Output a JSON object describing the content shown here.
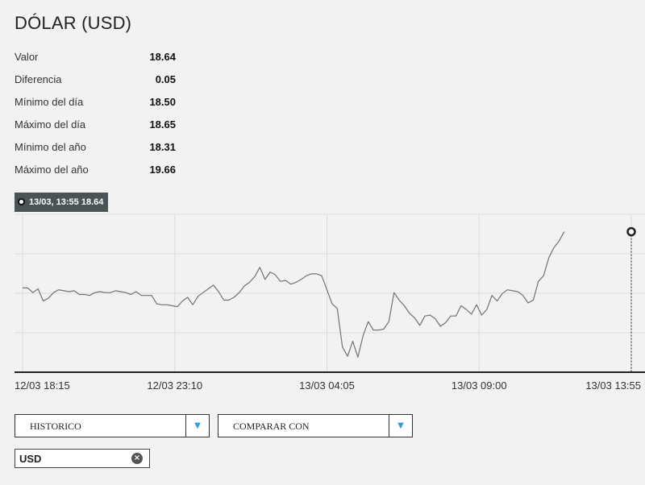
{
  "header": {
    "title": "DÓLAR (USD)"
  },
  "stats": [
    {
      "label": "Valor",
      "value": "18.64"
    },
    {
      "label": "Diferencia",
      "value": "0.05"
    },
    {
      "label": "Mínimo del día",
      "value": "18.50"
    },
    {
      "label": "Máximo del día",
      "value": "18.65"
    },
    {
      "label": "Mínimo del año",
      "value": "18.31"
    },
    {
      "label": "Máximo del año",
      "value": "19.66"
    }
  ],
  "tooltip": {
    "text": "13/03, 13:55 18.64"
  },
  "controls": {
    "historico_label": "HISTORICO",
    "comparar_label": "COMPARAR CON",
    "dropdown_arrow": "▼",
    "chip_label": "USD",
    "chip_close": "×"
  },
  "colors": {
    "line": "#6d7474",
    "grid": "#dcdcdc",
    "axis": "#222222",
    "tooltip_bg": "#4a5456",
    "dropdown_arrow": "#3a9ad9"
  },
  "chart_data": {
    "type": "line",
    "x_tick_labels": [
      "12/03 18:15",
      "12/03 23:10",
      "13/03 04:05",
      "13/03 09:00",
      "13/03 13:55"
    ],
    "x_range": [
      "12/03 18:15",
      "13/03 13:55"
    ],
    "ylim": [
      18.49,
      18.65
    ],
    "grid": true,
    "series": [
      {
        "x_minutes": [
          0,
          10,
          20,
          30,
          40,
          50,
          60,
          70,
          80,
          90,
          100,
          110,
          120,
          130,
          140,
          150,
          160,
          170,
          180,
          190,
          200,
          210,
          220,
          230,
          240,
          250,
          260,
          270,
          280,
          290,
          300,
          310,
          320,
          330,
          340,
          350,
          360,
          370,
          380,
          390,
          400,
          410,
          420,
          430,
          440,
          450,
          460,
          470,
          480,
          490,
          500,
          510,
          520,
          530,
          540,
          550,
          560,
          570,
          580,
          590,
          600,
          610,
          620,
          630,
          640,
          650,
          660,
          670,
          680,
          690,
          700,
          710,
          720,
          730,
          740,
          750,
          760,
          770,
          780,
          790,
          800,
          810,
          820,
          830,
          840,
          850,
          860,
          870,
          880,
          890,
          900,
          910,
          920,
          930,
          940,
          950,
          960,
          970,
          980,
          990,
          1000,
          1010,
          1020,
          1030,
          1040,
          1050,
          1060,
          1070,
          1080,
          1090,
          1100,
          1110,
          1120,
          1130,
          1140,
          1150,
          1160,
          1170,
          1180
        ],
        "values": [
          18.58,
          18.58,
          18.575,
          18.579,
          18.566,
          18.569,
          18.575,
          18.578,
          18.577,
          18.576,
          18.577,
          18.573,
          18.573,
          18.572,
          18.575,
          18.576,
          18.575,
          18.575,
          18.577,
          18.576,
          18.575,
          18.573,
          18.576,
          18.572,
          18.572,
          18.572,
          18.563,
          18.562,
          18.562,
          18.561,
          18.56,
          18.566,
          18.57,
          18.562,
          18.571,
          18.575,
          18.579,
          18.583,
          18.576,
          18.567,
          18.567,
          18.57,
          18.575,
          18.582,
          18.586,
          18.592,
          18.602,
          18.589,
          18.597,
          18.594,
          18.587,
          18.588,
          18.584,
          18.586,
          18.589,
          18.593,
          18.595,
          18.595,
          18.593,
          18.578,
          18.563,
          18.558,
          18.517,
          18.507,
          18.523,
          18.506,
          18.529,
          18.544,
          18.535,
          18.535,
          18.536,
          18.544,
          18.575,
          18.567,
          18.561,
          18.553,
          18.548,
          18.54,
          18.55,
          18.551,
          18.547,
          18.539,
          18.543,
          18.55,
          18.55,
          18.561,
          18.557,
          18.552,
          18.562,
          18.551,
          18.557,
          18.572,
          18.566,
          18.574,
          18.578,
          18.577,
          18.576,
          18.572,
          18.564,
          18.567,
          18.587,
          18.593,
          18.612,
          18.623,
          18.63,
          18.64
        ]
      }
    ]
  }
}
